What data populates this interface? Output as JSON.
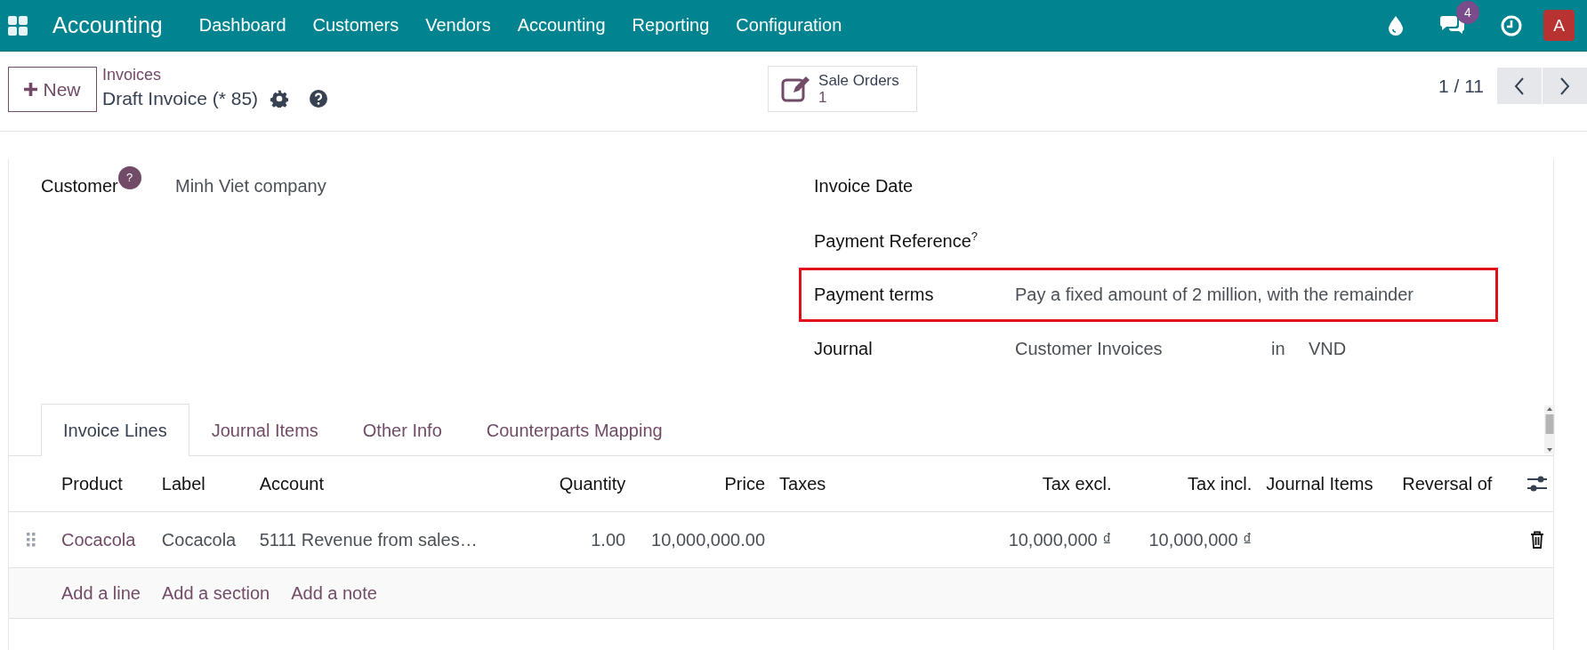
{
  "navbar": {
    "app_name": "Accounting",
    "menu": [
      "Dashboard",
      "Customers",
      "Vendors",
      "Accounting",
      "Reporting",
      "Configuration"
    ],
    "message_count": "4",
    "avatar": "A"
  },
  "control_panel": {
    "new_button": "New",
    "breadcrumb": "Invoices",
    "record_title": "Draft Invoice (* 85)",
    "smart_button": {
      "label": "Sale Orders",
      "count": "1"
    },
    "pager": "1 / 11"
  },
  "form": {
    "left_fields": [
      {
        "label": "Customer",
        "help": "?",
        "value": "Minh Viet company"
      }
    ],
    "right_fields": [
      {
        "kind": "plain",
        "label": "Invoice Date",
        "highlighted": false
      },
      {
        "kind": "help",
        "label": "Payment Reference",
        "help": "?",
        "highlighted": false
      },
      {
        "kind": "plain",
        "label": "Payment terms",
        "value": "Pay a fixed amount of 2 million, with the remainder",
        "highlighted": true
      },
      {
        "kind": "journal",
        "label": "Journal",
        "value": "Customer Invoices",
        "joiner": "in",
        "currency": "VND",
        "highlighted": false
      }
    ]
  },
  "tabs": [
    {
      "label": "Invoice Lines",
      "selected": true
    },
    {
      "label": "Journal Items",
      "selected": false
    },
    {
      "label": "Other Info",
      "selected": false
    },
    {
      "label": "Counterparts Mapping",
      "selected": false
    }
  ],
  "table": {
    "columns": [
      "Product",
      "Label",
      "Account",
      "Quantity",
      "Price",
      "Taxes",
      "Tax excl.",
      "Tax incl.",
      "Journal Items",
      "Reversal of"
    ],
    "rows": [
      {
        "product": "Cocacola",
        "label": "Cocacola",
        "account": "5111 Revenue from sales…",
        "quantity": "1.00",
        "price": "10,000,000.00",
        "tax_excl": "10,000,000 ₫",
        "tax_incl": "10,000,000 ₫"
      }
    ],
    "add_links": [
      "Add a line",
      "Add a section",
      "Add a note"
    ]
  }
}
